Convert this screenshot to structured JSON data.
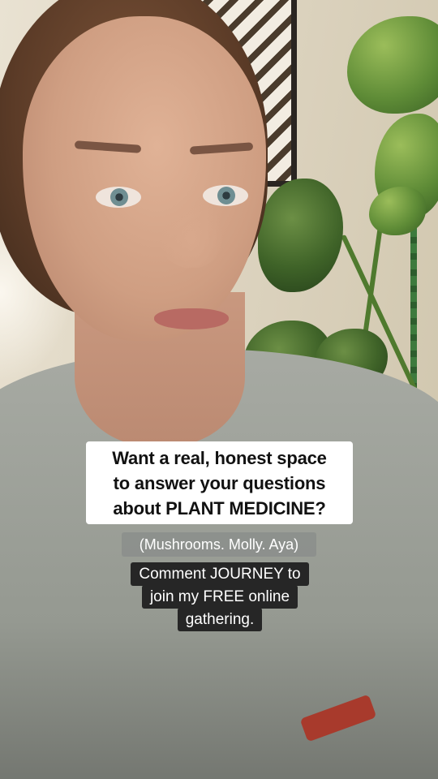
{
  "caption_main": {
    "lines": [
      "Want a real, honest space",
      "to answer your questions",
      "about PLANT MEDICINE?"
    ]
  },
  "caption_sub": "(Mushrooms. Molly. Aya)",
  "caption_cta": {
    "lines": [
      "Comment JOURNEY to",
      "join my FREE online",
      "gathering."
    ]
  },
  "colors": {
    "main_caption_bg": "#ffffff",
    "sub_caption_bg": "#8c8f8c",
    "cta_caption_bg": "#262626"
  }
}
